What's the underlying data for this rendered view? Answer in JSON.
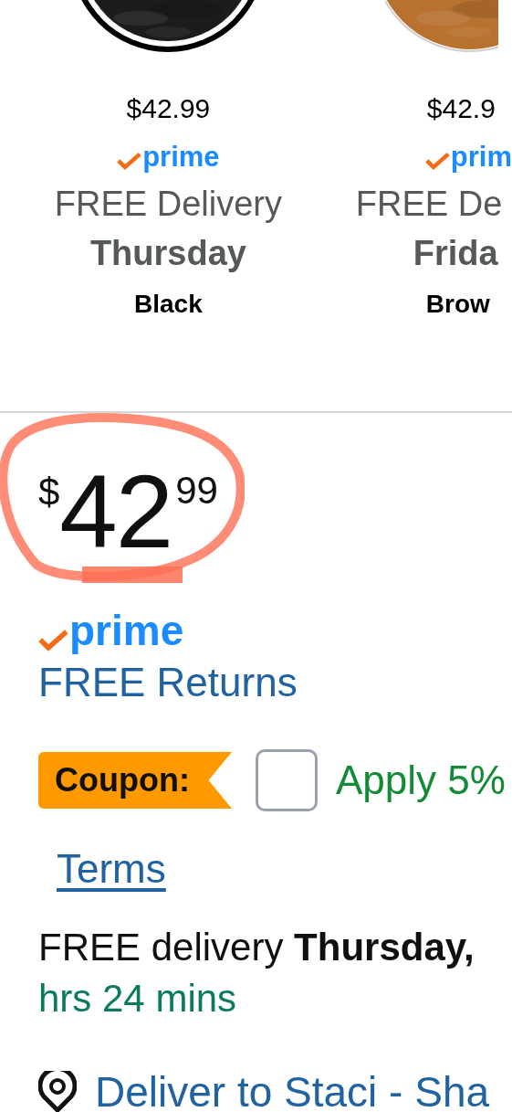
{
  "variants": [
    {
      "color": "#1c1c1c",
      "selected": true,
      "price": "$42.99",
      "badge": "prime",
      "delivery": "FREE Delivery",
      "day": "Thursday",
      "name": "Black"
    },
    {
      "color": "#b8712f",
      "selected": false,
      "price": "$42.9",
      "badge": "prim",
      "delivery": "FREE De",
      "day": "Frida",
      "name": "Brow"
    }
  ],
  "price": {
    "symbol": "$",
    "whole": "42",
    "fraction": "99",
    "circled": true
  },
  "badge": "prime",
  "returns_link": "FREE Returns",
  "coupon": {
    "label": "Coupon:",
    "checked": false,
    "text": "Apply 5%",
    "terms_link": "Terms"
  },
  "delivery": {
    "line": "FREE delivery **Thursday,**",
    "countdown": "hrs 24 mins"
  },
  "location_link": "Deliver to Staci - Sha"
}
